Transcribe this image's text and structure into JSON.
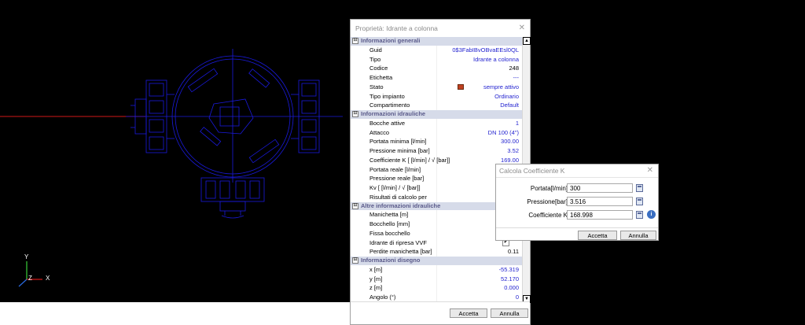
{
  "axes": {
    "x": "X",
    "y": "Y",
    "z": "Z"
  },
  "panel": {
    "title": "Proprietà: Idrante a colonna",
    "close": "✕",
    "groups": [
      {
        "title": "Informazioni generali",
        "toggle": "⊟",
        "rows": [
          {
            "key": "Guid",
            "value": "0$3FabIBvOBvaEEsl0QL"
          },
          {
            "key": "Tipo",
            "value": "Idrante a colonna"
          },
          {
            "key": "Codice",
            "value": "248",
            "dark": true
          },
          {
            "key": "Etichetta",
            "value": "---"
          },
          {
            "key": "Stato",
            "value": "sempre attivo",
            "icon": "stato-icon"
          },
          {
            "key": "Tipo impianto",
            "value": "Ordinario"
          },
          {
            "key": "Compartimento",
            "value": "Default"
          }
        ]
      },
      {
        "title": "Informazioni idrauliche",
        "toggle": "⊟",
        "rows": [
          {
            "key": "Bocche attive",
            "value": "1"
          },
          {
            "key": "Attacco",
            "value": "DN 100 (4\")"
          },
          {
            "key": "Portata minima [l/min]",
            "value": "300.00"
          },
          {
            "key": "Pressione minima [bar]",
            "value": "3.52"
          },
          {
            "key": "Coefficiente K [ [l/min] / √ [bar]]",
            "value": "169.00"
          },
          {
            "key": "Portata reale [l/min]",
            "value": ""
          },
          {
            "key": "Pressione reale [bar]",
            "value": ""
          },
          {
            "key": "Kv [ [l/min] / √ [bar]]",
            "value": ""
          },
          {
            "key": "Risultati di calcolo per",
            "value": ""
          }
        ]
      },
      {
        "title": "Altre informazioni idrauliche",
        "toggle": "⊟",
        "rows": [
          {
            "key": "Manichetta [m]",
            "value": ""
          },
          {
            "key": "Bocchello [mm]",
            "value": ""
          },
          {
            "key": "Fissa bocchello",
            "checkbox": ""
          },
          {
            "key": "Idrante di ripresa VVF",
            "checkbox": "✔"
          },
          {
            "key": "Perdite manichetta [bar]",
            "value": "0.11",
            "dark": true
          }
        ]
      },
      {
        "title": "Informazioni disegno",
        "toggle": "⊟",
        "rows": [
          {
            "key": "x [m]",
            "value": "-55.319"
          },
          {
            "key": "y [m]",
            "value": "52.170"
          },
          {
            "key": "z [m]",
            "value": "0.000"
          },
          {
            "key": "Angolo (°)",
            "value": "0"
          }
        ]
      }
    ],
    "ok_label": "Accetta",
    "cancel_label": "Annulla",
    "scroll_up": "▲",
    "scroll_down": "▼"
  },
  "dialog": {
    "title": "Calcola Coefficiente K",
    "close": "✕",
    "fields": [
      {
        "label": "Portata[l/min]",
        "value": "300",
        "name": "portata"
      },
      {
        "label": "Pressione[bar]",
        "value": "3.516",
        "name": "pressione"
      },
      {
        "label": "Coefficiente K",
        "value": "168.998",
        "name": "coefficiente-k"
      }
    ],
    "info": "i",
    "ok_label": "Accetta",
    "cancel_label": "Annulla"
  },
  "colors": {
    "cad_line": "#1a1adc",
    "axis_red": "#d01818",
    "accent_text": "#1f1fcf",
    "group_bg": "#d6dbe9"
  }
}
